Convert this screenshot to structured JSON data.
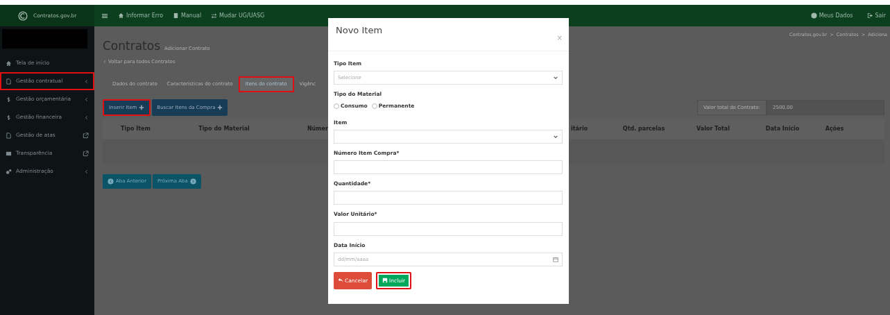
{
  "topbar": {
    "brand": "Contratos.gov.br",
    "links": [
      "Informar Erro",
      "Manual",
      "Mudar UG/UASG"
    ],
    "right_links": [
      "Meus Dados",
      "Sair"
    ]
  },
  "sidebar": {
    "items": [
      {
        "label": "Tela de início",
        "highlighted": false
      },
      {
        "label": "Gestão contratual",
        "highlighted": true
      },
      {
        "label": "Gestão orçamentária",
        "highlighted": false
      },
      {
        "label": "Gestão financeira",
        "highlighted": false
      },
      {
        "label": "Gestão de atas",
        "highlighted": false
      },
      {
        "label": "Transparência",
        "highlighted": false
      },
      {
        "label": "Administração",
        "highlighted": false
      }
    ]
  },
  "page": {
    "title": "Contratos",
    "subtitle": "Adicionar Contrato",
    "back_link": "Voltar para todos Contratos",
    "breadcrumb": "Contratos.gov.br  >  Contratos  >  Adiciona",
    "tabs": [
      {
        "label": "Dados do contrato",
        "selected": false,
        "highlighted": false
      },
      {
        "label": "Características do contrato",
        "selected": false,
        "highlighted": false
      },
      {
        "label": "Itens do contrato",
        "selected": true,
        "highlighted": true
      },
      {
        "label": "Vigênc",
        "selected": false,
        "highlighted": false
      }
    ],
    "actions": [
      {
        "label": "Inserir Item",
        "highlighted": true
      },
      {
        "label": "Buscar Itens da Compra",
        "highlighted": false
      }
    ],
    "total": {
      "label": "Valor total do Contrato:",
      "value": "2500,00"
    },
    "table": {
      "columns": [
        "Tipo Item",
        "Tipo do Material",
        "Númer",
        "itário",
        "Qtd. parcelas",
        "Valor Total",
        "Data Início",
        "Ações"
      ]
    },
    "nav_buttons": [
      "Aba Anterior",
      "Próxima Aba"
    ]
  },
  "modal": {
    "title": "Novo Item",
    "close": "×",
    "fields": [
      {
        "label": "Tipo Item",
        "kind": "select",
        "placeholder": "Selecione"
      },
      {
        "label": "Tipo do Material",
        "kind": "radio",
        "options": [
          {
            "label": "Consumo",
            "selected": false
          },
          {
            "label": "Permanente",
            "selected": false
          }
        ]
      },
      {
        "label": "Item",
        "kind": "select"
      },
      {
        "label": "Número Item Compra*",
        "kind": "input"
      },
      {
        "label": "Quantidade*",
        "kind": "input"
      },
      {
        "label": "Valor Unitário*",
        "kind": "input"
      },
      {
        "label": "Data Início",
        "kind": "date",
        "placeholder": "dd/mm/aaaa"
      }
    ],
    "buttons": [
      {
        "label": "Cancelar",
        "kind": "cancel",
        "highlighted": false
      },
      {
        "label": "Incluir",
        "kind": "submit",
        "highlighted": true
      }
    ]
  }
}
